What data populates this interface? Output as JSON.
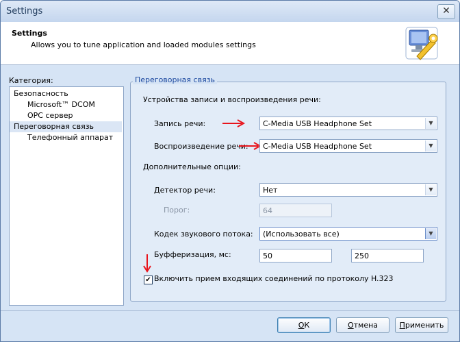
{
  "window": {
    "title": "Settings",
    "close_glyph": "✕"
  },
  "header": {
    "title": "Settings",
    "description": "Allows you to tune application and loaded modules settings",
    "icon": "settings-wrench-icon"
  },
  "category": {
    "label": "Категория:",
    "items": [
      {
        "label": "Безопасность",
        "level": 0,
        "selected": false
      },
      {
        "label": "Microsoft™ DCOM",
        "level": 1,
        "selected": false
      },
      {
        "label": "OPC сервер",
        "level": 1,
        "selected": false
      },
      {
        "label": "Переговорная связь",
        "level": 0,
        "selected": true
      },
      {
        "label": "Телефонный аппарат",
        "level": 1,
        "selected": false
      }
    ]
  },
  "panel": {
    "legend": "Переговорная связь",
    "devices_section": "Устройства записи и воспроизведения речи:",
    "record_label": "Запись речи:",
    "record_value": "C-Media USB Headphone Set",
    "playback_label": "Воспроизведение речи:",
    "playback_value": "C-Media USB Headphone Set",
    "options_section": "Дополнительные опции:",
    "detector_label": "Детектор речи:",
    "detector_value": "Нет",
    "threshold_label": "Порог:",
    "threshold_value": "64",
    "codec_label": "Кодек звукового потока:",
    "codec_value": "(Использовать все)",
    "buffer_label": "Буфферизация, мс:",
    "buffer_min": "50",
    "buffer_max": "250",
    "h323_label": "Включить прием входящих соединений по протоколу H.323",
    "h323_checked": true
  },
  "buttons": {
    "ok_hot": "О",
    "ok_rest": "К",
    "cancel_hot": "О",
    "cancel_rest": "тмена",
    "apply_hot": "П",
    "apply_rest": "рименить"
  },
  "colors": {
    "annotation_arrow": "#e8141c",
    "accent": "#1e4aa0"
  }
}
